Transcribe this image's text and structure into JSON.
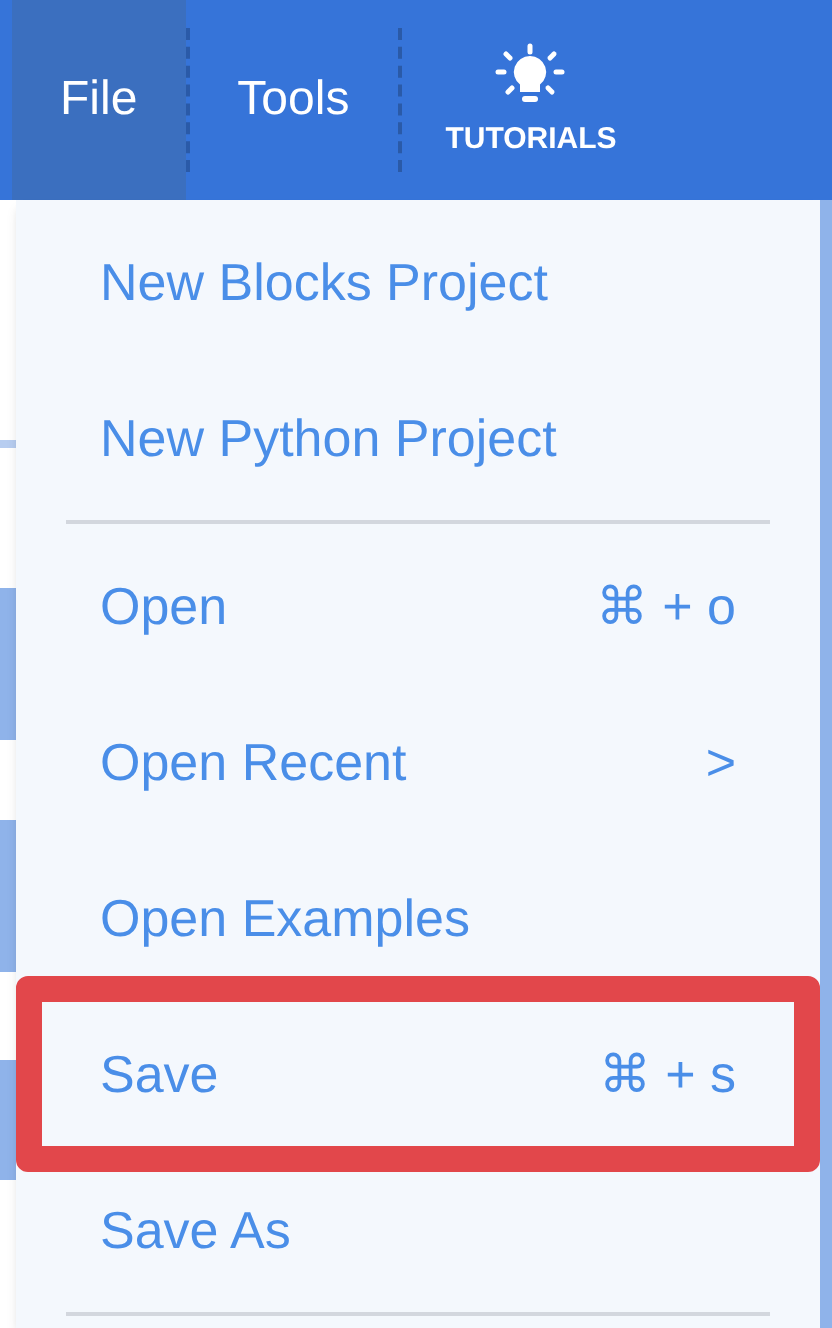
{
  "menu_bar": [
    {
      "label": "File",
      "selected": true,
      "kind": "text"
    },
    {
      "label": "Tools",
      "selected": false,
      "kind": "text"
    },
    {
      "label": "TUTORIALS",
      "selected": false,
      "kind": "icon"
    }
  ],
  "file_menu": [
    {
      "kind": "item",
      "label": "New Blocks Project",
      "highlighted": false
    },
    {
      "kind": "item",
      "label": "New Python Project",
      "highlighted": false
    },
    {
      "kind": "divider"
    },
    {
      "kind": "item",
      "label": "Open",
      "shortcut": "⌘ + o",
      "highlighted": false
    },
    {
      "kind": "item",
      "label": "Open Recent",
      "shortcut": ">",
      "highlighted": false
    },
    {
      "kind": "item",
      "label": "Open Examples",
      "highlighted": false
    },
    {
      "kind": "item",
      "label": "Save",
      "shortcut": "⌘ + s",
      "highlighted": true
    },
    {
      "kind": "item",
      "label": "Save As",
      "highlighted": false
    },
    {
      "kind": "divider"
    }
  ]
}
